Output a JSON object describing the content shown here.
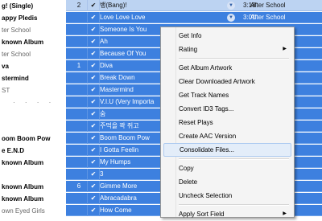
{
  "albums": [
    {
      "text": "g! (Single)",
      "style": "b"
    },
    {
      "text": "appy Pledis",
      "style": "b"
    },
    {
      "text": "ter School",
      "style": "m"
    },
    {
      "text": "known Album",
      "style": "b"
    },
    {
      "text": "ter School",
      "style": "m"
    },
    {
      "text": "va",
      "style": "b"
    },
    {
      "text": "stermind",
      "style": "b"
    },
    {
      "text": "ST",
      "style": "m"
    },
    {
      "text": "· · · ·",
      "style": "g"
    },
    {
      "text": "",
      "style": "m"
    },
    {
      "text": "",
      "style": "m"
    },
    {
      "text": "oom Boom Pow",
      "style": "b"
    },
    {
      "text": "e E.N.D",
      "style": "b"
    },
    {
      "text": "known Album",
      "style": "b"
    },
    {
      "text": "",
      "style": "m"
    },
    {
      "text": "known Album",
      "style": "b"
    },
    {
      "text": "known Album",
      "style": "b"
    },
    {
      "text": "own Eyed Girls",
      "style": "m"
    }
  ],
  "tracks": [
    {
      "num": "2",
      "checked": true,
      "name": "뱅(Bang)!",
      "time": "3:18",
      "artist": "After School"
    },
    {
      "num": "",
      "checked": true,
      "name": "Love Love Love",
      "time": "3:01",
      "artist": "After School"
    },
    {
      "num": "",
      "checked": true,
      "name": "Someone Is You",
      "time": "",
      "artist": ""
    },
    {
      "num": "",
      "checked": true,
      "name": "Ah",
      "time": "",
      "artist": ""
    },
    {
      "num": "",
      "checked": true,
      "name": "Because Of You",
      "time": "",
      "artist": ""
    },
    {
      "num": "1",
      "checked": true,
      "name": "Diva",
      "time": "",
      "artist": ""
    },
    {
      "num": "",
      "checked": true,
      "name": "Break Down",
      "time": "",
      "artist": ""
    },
    {
      "num": "",
      "checked": true,
      "name": "Mastermind",
      "time": "",
      "artist": ""
    },
    {
      "num": "",
      "checked": true,
      "name": "V.I.U (Very Importa",
      "time": "",
      "artist": ""
    },
    {
      "num": "",
      "checked": true,
      "name": "숨",
      "time": "",
      "artist": ""
    },
    {
      "num": "",
      "checked": true,
      "name": "주먹을 꽉 쥐고",
      "time": "",
      "artist": ""
    },
    {
      "num": "",
      "checked": true,
      "name": "Boom Boom Pow",
      "time": "",
      "artist": "as"
    },
    {
      "num": "",
      "checked": true,
      "name": "I Gotta Feelin",
      "time": "",
      "artist": "as"
    },
    {
      "num": "",
      "checked": true,
      "name": "My Humps",
      "time": "",
      "artist": "as"
    },
    {
      "num": "",
      "checked": true,
      "name": "3",
      "time": "",
      "artist": ""
    },
    {
      "num": "6",
      "checked": true,
      "name": "Gimme More",
      "time": "",
      "artist": ""
    },
    {
      "num": "",
      "checked": true,
      "name": "Abracadabra",
      "time": "",
      "artist": "Girls"
    },
    {
      "num": "",
      "checked": true,
      "name": "How Come",
      "time": "",
      "artist": "Girls"
    }
  ],
  "check_glyph": "✔",
  "dropdown_glyph": "▼",
  "submenu_glyph": "▶",
  "menu": {
    "items": [
      {
        "label": "Get Info",
        "submenu": false,
        "sep_after": false
      },
      {
        "label": "Rating",
        "submenu": true,
        "sep_after": true
      },
      {
        "label": "Get Album Artwork",
        "submenu": false,
        "sep_after": false
      },
      {
        "label": "Clear Downloaded Artwork",
        "submenu": false,
        "sep_after": false
      },
      {
        "label": "Get Track Names",
        "submenu": false,
        "sep_after": false
      },
      {
        "label": "Convert ID3 Tags...",
        "submenu": false,
        "sep_after": false
      },
      {
        "label": "Reset Plays",
        "submenu": false,
        "sep_after": false
      },
      {
        "label": "Create AAC Version",
        "submenu": false,
        "sep_after": false
      },
      {
        "label": "Consolidate Files...",
        "submenu": false,
        "sep_after": true,
        "highlighted": true
      },
      {
        "label": "Copy",
        "submenu": false,
        "sep_after": false
      },
      {
        "label": "Delete",
        "submenu": false,
        "sep_after": false
      },
      {
        "label": "Uncheck Selection",
        "submenu": false,
        "sep_after": true
      },
      {
        "label": "Apply Sort Field",
        "submenu": true,
        "sep_after": false
      }
    ]
  }
}
